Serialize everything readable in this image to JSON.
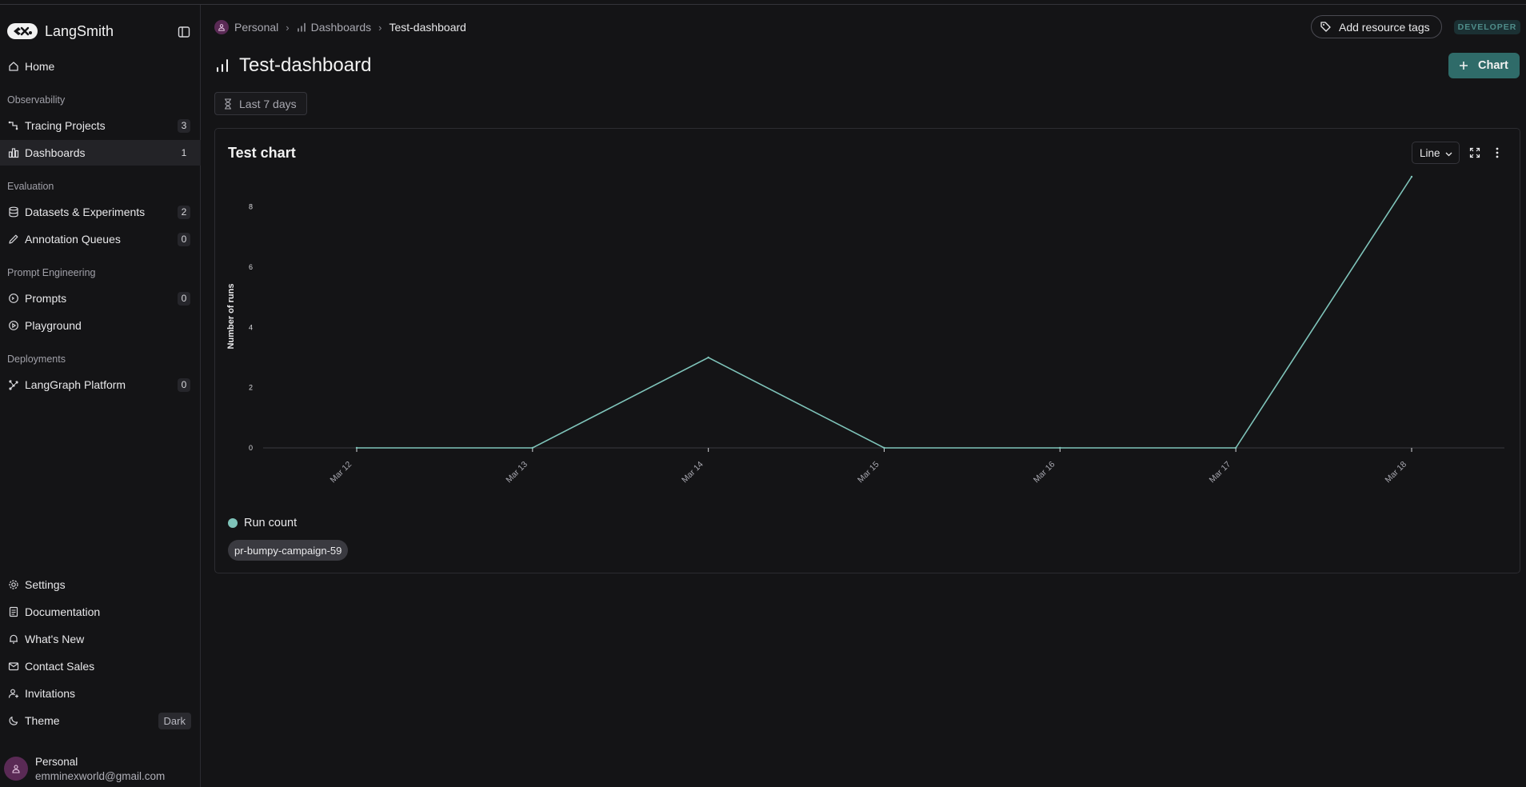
{
  "app": {
    "name": "LangSmith"
  },
  "sidebar": {
    "home": {
      "label": "Home"
    },
    "sections": {
      "observability": "Observability",
      "evaluation": "Evaluation",
      "prompt_engineering": "Prompt Engineering",
      "deployments": "Deployments"
    },
    "items": {
      "tracing_projects": {
        "label": "Tracing Projects",
        "count": "3"
      },
      "dashboards": {
        "label": "Dashboards",
        "count": "1"
      },
      "datasets": {
        "label": "Datasets & Experiments",
        "count": "2"
      },
      "annotation_queues": {
        "label": "Annotation Queues",
        "count": "0"
      },
      "prompts": {
        "label": "Prompts",
        "count": "0"
      },
      "playground": {
        "label": "Playground"
      },
      "langgraph": {
        "label": "LangGraph Platform",
        "count": "0"
      }
    },
    "bottom": {
      "settings": "Settings",
      "documentation": "Documentation",
      "whats_new": "What's New",
      "contact_sales": "Contact Sales",
      "invitations": "Invitations",
      "theme": "Theme",
      "theme_value": "Dark"
    },
    "profile": {
      "name": "Personal",
      "email": "emminexworld@gmail.com"
    }
  },
  "header": {
    "breadcrumb": [
      "Personal",
      "Dashboards",
      "Test-dashboard"
    ],
    "add_tags_label": "Add resource tags",
    "plan_badge": "DEVELOPER",
    "title": "Test-dashboard",
    "add_chart_label": "Chart",
    "date_range": "Last 7 days"
  },
  "chart_card": {
    "title": "Test chart",
    "chart_type_select": "Line",
    "legend_label": "Run count",
    "series_chip": "pr-bumpy-campaign-59"
  },
  "colors": {
    "accent": "#2f6b69",
    "series": "#7fc4ba",
    "background": "#141416",
    "sidebar_active": "#232327"
  },
  "chart_data": {
    "type": "line",
    "ylabel": "Number of runs",
    "xlabel": "",
    "x": [
      "Mar 12",
      "Mar 13",
      "Mar 14",
      "Mar 15",
      "Mar 16",
      "Mar 17",
      "Mar 18"
    ],
    "yticks": [
      0,
      2,
      4,
      6,
      8
    ],
    "ylim": [
      0,
      9
    ],
    "series": [
      {
        "name": "Run count",
        "values": [
          0,
          0,
          3,
          0,
          0,
          0,
          9
        ]
      }
    ]
  }
}
